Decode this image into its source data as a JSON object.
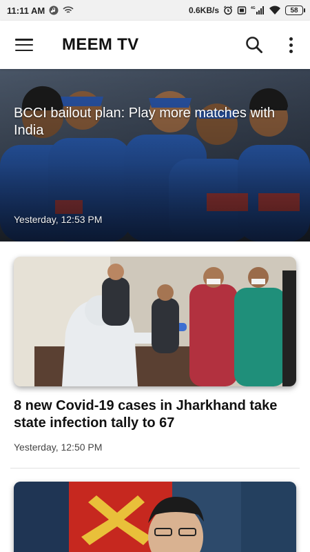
{
  "status_bar": {
    "time": "11:11 AM",
    "speed": "0.6KB/s",
    "battery": "58",
    "network": "4G",
    "icons": [
      "app-notification-icon",
      "wifi-icon",
      "alarm-icon",
      "vibrate-icon",
      "signal-icon",
      "wifi-icon",
      "battery-icon"
    ]
  },
  "app_bar": {
    "title": "MEEM TV",
    "icons": {
      "menu": "menu-icon",
      "search": "search-icon",
      "more": "more-vert-icon"
    }
  },
  "articles": [
    {
      "title": "BCCI bailout plan: Play more matches with India",
      "time": "Yesterday, 12:53 PM",
      "style": "hero"
    },
    {
      "title": "8 new Covid-19 cases in Jharkhand take state infection tally to 67",
      "time": "Yesterday, 12:50 PM",
      "style": "card"
    },
    {
      "title": "",
      "time": "",
      "style": "card"
    }
  ],
  "colors": {
    "accent": "#1f3b8f",
    "background": "#ffffff",
    "status_bar": "#f1f1f1"
  }
}
